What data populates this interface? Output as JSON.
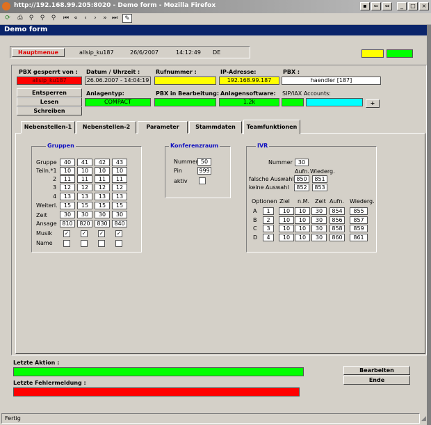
{
  "window": {
    "title": "http://192.168.99.205:8020 - Demo form - Mozilla Firefox",
    "controls": [
      "_",
      "□",
      "×"
    ]
  },
  "toolbar": {
    "icons": [
      "refresh-icon",
      "print-icon",
      "find-icon",
      "find-all-icon",
      "first-icon",
      "prev-page-icon",
      "prev-icon",
      "next-icon",
      "next-page-icon",
      "last-icon",
      "edit-icon"
    ]
  },
  "form": {
    "title": "Demo form",
    "hauptmenue_label": "Hauptmenue",
    "user": "allsip_ku187",
    "date": "26/6/2007",
    "time": "14:12:49",
    "lang": "DE"
  },
  "pbx": {
    "gesperrt_label": "PBX gesperrt von :",
    "gesperrt_value": "allsip_ku187",
    "datum_label": "Datum / Uhrzeit :",
    "datum_value": "26.06.2007 - 14:04:19",
    "rufnummer_label": "Rufnummer :",
    "rufnummer_value": "",
    "ip_label": "IP-Adresse:",
    "ip_value": "192.168.99.187",
    "pbx_label": "PBX :",
    "pbx_value": "haendler [187]",
    "entsperren_label": "Entsperren",
    "lesen_label": "Lesen",
    "schreiben_label": "Schreiben",
    "anlagentyp_label": "Anlagentyp:",
    "anlagentyp_value": "COMPACT",
    "bearbeitung_label": "PBX in Bearbeitung:",
    "bearbeitung_value": "",
    "software_label": "Anlagensoftware:",
    "software_value": "1.2k",
    "sip_label": "SIP/IAX Accounts:",
    "sip_value": "",
    "plus_label": "+"
  },
  "tabs": [
    "Nebenstellen-1",
    "Nebenstellen-2",
    "Parameter",
    "Stammdaten",
    "Teamfunktionen"
  ],
  "gruppen": {
    "title": "Gruppen",
    "row_labels": [
      "Gruppe",
      "Teiln.*1",
      "2",
      "3",
      "4",
      "Weiterl.",
      "Zeit",
      "Ansage",
      "Musik",
      "Name"
    ],
    "gruppe": [
      "40",
      "41",
      "42",
      "43"
    ],
    "teiln1": [
      "10",
      "10",
      "10",
      "10"
    ],
    "teiln2": [
      "11",
      "11",
      "11",
      "11"
    ],
    "teiln3": [
      "12",
      "12",
      "12",
      "12"
    ],
    "teiln4": [
      "13",
      "13",
      "13",
      "13"
    ],
    "weiterl": [
      "15",
      "15",
      "15",
      "15"
    ],
    "zeit": [
      "30",
      "30",
      "30",
      "30"
    ],
    "ansage": [
      "810",
      "820",
      "830",
      "840"
    ],
    "musik_check": "✓"
  },
  "konferenz": {
    "title": "Konferenzraum",
    "nummer_label": "Nummer",
    "nummer_value": "50",
    "pin_label": "Pin",
    "pin_value": "999",
    "aktiv_label": "aktiv"
  },
  "ivr": {
    "title": "IVR",
    "nummer_label": "Nummer",
    "nummer_value": "30",
    "aufn_label": "Aufn.",
    "wiederg_label": "Wiederg.",
    "falsche_label": "falsche Auswahl",
    "falsche_aufn": "850",
    "falsche_wiederg": "851",
    "keine_label": "keine Auswahl",
    "keine_aufn": "852",
    "keine_wiederg": "853",
    "headers": [
      "Optionen",
      "Ziel",
      "n.M.",
      "Zeit",
      "Aufn.",
      "Wiederg."
    ],
    "options": [
      {
        "letter": "A",
        "num": "1",
        "ziel": "10",
        "nm": "10",
        "zeit": "30",
        "aufn": "854",
        "wiederg": "855"
      },
      {
        "letter": "B",
        "num": "2",
        "ziel": "10",
        "nm": "10",
        "zeit": "30",
        "aufn": "856",
        "wiederg": "857"
      },
      {
        "letter": "C",
        "num": "3",
        "ziel": "10",
        "nm": "10",
        "zeit": "30",
        "aufn": "858",
        "wiederg": "859"
      },
      {
        "letter": "D",
        "num": "4",
        "ziel": "10",
        "nm": "10",
        "zeit": "30",
        "aufn": "860",
        "wiederg": "861"
      }
    ]
  },
  "bottom": {
    "letzte_aktion_label": "Letzte Aktion :",
    "letzte_fehler_label": "Letzte Fehlermeldung :",
    "bearbeiten_label": "Bearbeiten",
    "ende_label": "Ende"
  },
  "status": {
    "text": "Fertig"
  }
}
